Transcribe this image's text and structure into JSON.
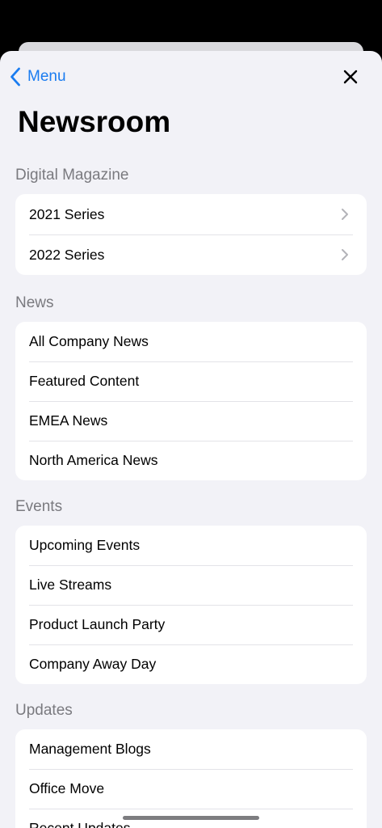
{
  "nav": {
    "back_label": "Menu"
  },
  "title": "Newsroom",
  "sections": [
    {
      "header": "Digital Magazine",
      "items": [
        {
          "label": "2021 Series"
        },
        {
          "label": "2022 Series"
        }
      ]
    },
    {
      "header": "News",
      "items": [
        {
          "label": "All Company News"
        },
        {
          "label": "Featured Content"
        },
        {
          "label": "EMEA News"
        },
        {
          "label": "North America News"
        }
      ]
    },
    {
      "header": "Events",
      "items": [
        {
          "label": "Upcoming Events"
        },
        {
          "label": "Live Streams"
        },
        {
          "label": "Product Launch Party"
        },
        {
          "label": "Company Away Day"
        }
      ]
    },
    {
      "header": "Updates",
      "items": [
        {
          "label": "Management Blogs"
        },
        {
          "label": "Office Move"
        },
        {
          "label": "Recent Updates"
        }
      ]
    }
  ],
  "colors": {
    "accent": "#1a7cf0",
    "background": "#f2f2f7",
    "card": "#ffffff",
    "section_header": "#7a7a7f"
  },
  "icons": {
    "back": "chevron-left-icon",
    "close": "close-icon",
    "disclosure": "chevron-right-icon"
  }
}
